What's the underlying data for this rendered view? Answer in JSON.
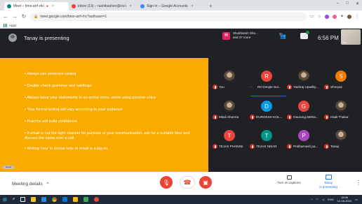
{
  "browser": {
    "tabs": [
      {
        "label": "Meet – bmx-arrf-rhc",
        "active": true,
        "fav_color": "#00897b"
      },
      {
        "label": "Inbox (19) – rashibashen@icici",
        "active": false,
        "fav_color": "#ea4335"
      },
      {
        "label": "Sign in – Google Accounts",
        "active": false,
        "fav_color": "#4285f4"
      }
    ],
    "new_tab": "+",
    "window_controls": [
      "–",
      "□",
      "✕"
    ],
    "url": "meet.google.com/bmx-arrf-rhc?authuser=1",
    "bookmarks_label": "Apps"
  },
  "meet": {
    "presenting_text": "Tanay is presenting",
    "people_summary_line1": "Shubhansh Sho...",
    "people_summary_line2": "and 37 more",
    "people_badge": "H",
    "people_count": "39",
    "time": "6:56 PM",
    "you_label": "You"
  },
  "slide": {
    "bullets": [
      "• Always use sentence casing",
      "• Double check grammar and spellings",
      "• Always keep your statements in an active voice; avoid using passive voice",
      "• Your formal writing will vary according to your audience",
      "• Practice will build confidence",
      "• If email is not the right channel for purpose of your communication, ask for a suitable time and discuss the same over a call.",
      "• Writing 'Hey' in formal note or email is a big no."
    ],
    "logo_text": "Ghost"
  },
  "participants": [
    {
      "name": "You",
      "initial": "",
      "color": "photo",
      "speaking": false
    },
    {
      "name": "Rtr Dimple Sur...",
      "initial": "R",
      "color": "#e8453c",
      "speaking": true
    },
    {
      "name": "Yashraj Upadhy...",
      "initial": "",
      "color": "photo",
      "speaking": false
    },
    {
      "name": "Shreyas",
      "initial": "S",
      "color": "#f57c00",
      "speaking": false
    },
    {
      "name": "Mitali Sharma",
      "initial": "",
      "color": "photo",
      "speaking": false
    },
    {
      "name": "DURGESH KOL...",
      "initial": "D",
      "color": "#039be5",
      "speaking": false
    },
    {
      "name": "Gaurang Mehta...",
      "initial": "G",
      "color": "#e8453c",
      "speaking": false
    },
    {
      "name": "Hitali Thakur",
      "initial": "",
      "color": "photo",
      "speaking": false
    },
    {
      "name": "TEJAS PHANSE",
      "initial": "T",
      "color": "#e8453c",
      "speaking": false
    },
    {
      "name": "TEJAS NISAR",
      "initial": "T",
      "color": "#009688",
      "speaking": false
    },
    {
      "name": "Pratharnesh pa...",
      "initial": "P",
      "color": "#ab47bc",
      "speaking": false
    },
    {
      "name": "Tanay",
      "initial": "",
      "color": "photo",
      "speaking": false
    }
  ],
  "bottombar": {
    "meeting_details": "Meeting details",
    "chevron": "^",
    "captions_label": "Turn on captions",
    "presenting_line1": "Tanay",
    "presenting_line2": "is presenting",
    "more": "⋮"
  },
  "taskbar": {
    "lang": "ENG",
    "time": "18:56",
    "date": "12-08-2020"
  }
}
